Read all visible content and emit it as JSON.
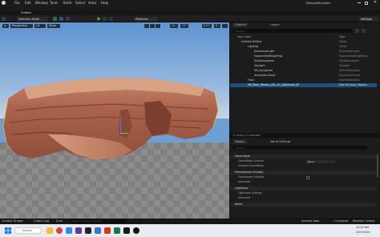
{
  "window": {
    "project_name": "KidbeyilMountaint",
    "level_name": "Untitled"
  },
  "menu": {
    "items": [
      "File",
      "Edit",
      "Window",
      "Tools",
      "Build",
      "Select",
      "Actor",
      "Help"
    ]
  },
  "toolbar": {
    "selection_mode": "Selection Mode",
    "platforms": "Platforms",
    "settings": "Settings"
  },
  "viewport": {
    "perspective": "Perspective",
    "lit": "Lit",
    "show": "Show",
    "grid_snap": "10",
    "rotation_snap": "10°",
    "scale_snap": "0.25",
    "camera_speed": "4"
  },
  "outliner": {
    "tab_outliner": "Outliner",
    "tab_layers": "Layers",
    "search_placeholder": "Search...",
    "col_item": "Item Label",
    "col_type": "Type",
    "rows": [
      {
        "label": "Untitled (Editor)",
        "type": "World"
      },
      {
        "label": "Lighting",
        "type": "Folder"
      },
      {
        "label": "DirectionalLight",
        "type": "DirectionalLight"
      },
      {
        "label": "ExponentialHeightFog",
        "type": "ExponentialHeightFog"
      },
      {
        "label": "SkyAtmosphere",
        "type": "SkyAtmosphere"
      },
      {
        "label": "SkyLight",
        "type": "SkyLight"
      },
      {
        "label": "SM_SkySphere",
        "type": "StaticMeshActor"
      },
      {
        "label": "VolumetricCloud",
        "type": "VolumetricCloud"
      },
      {
        "label": "Floor",
        "type": "StaticMeshActor"
      },
      {
        "label": "SM_Rock_Plateau_XXL_01_Optimized_SP",
        "type": "Edit SM_Rock_Plateau"
      }
    ],
    "footer": "11 actors (1 selected)"
  },
  "details": {
    "tab_details": "Details",
    "tab_world_settings": "World Settings",
    "search_placeholder": "Search",
    "sections": [
      {
        "title": "Game Mode",
        "props": [
          {
            "label": "GameMode Override",
            "value": "None"
          },
          {
            "label": "Selected GameMode",
            "value": ""
          }
        ]
      },
      {
        "title": "Precomputed Visibility",
        "props": [
          {
            "label": "Precompute Visibility",
            "value": ""
          },
          {
            "label": "Advanced",
            "value": ""
          }
        ]
      },
      {
        "title": "Lightmass",
        "props": [
          {
            "label": "Lightmass Settings",
            "value": ""
          },
          {
            "label": "Advanced",
            "value": ""
          }
        ]
      },
      {
        "title": "World",
        "props": []
      }
    ]
  },
  "statusbar": {
    "content_drawer": "Content Drawer",
    "output_log": "Output Log",
    "cmd": "Cmd",
    "cmd_placeholder": "Enter Console Command",
    "derived_data": "Derived Data",
    "unsaved": "1 Unsaved",
    "revision_control": "Revision Control"
  },
  "taskbar": {
    "search": "Search",
    "time": "12:00 AM",
    "date": "2/19/2024"
  },
  "colors": {
    "accent_selection": "#1f4f7f",
    "play_green": "#4fbf4f",
    "unreal_bg": "#1c1c1c"
  }
}
